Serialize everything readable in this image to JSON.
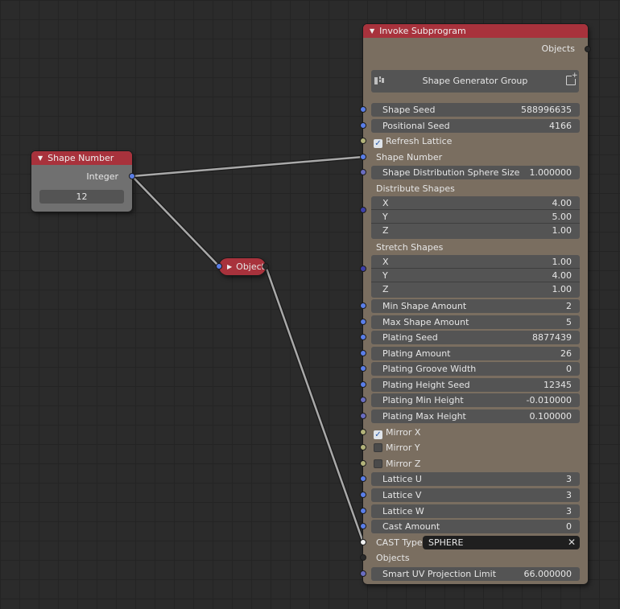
{
  "colors": {
    "header": "#a8323c",
    "socket_int": "#5a7ee8",
    "socket_float": "#6a6dc0",
    "socket_bool": "#b3b37a",
    "socket_object": "#f0f0f0"
  },
  "shape_number_node": {
    "title": "Shape Number",
    "output_label": "Integer",
    "value": "12"
  },
  "object_node": {
    "title": "Objects"
  },
  "invoke_node": {
    "title": "Invoke Subprogram",
    "output_label": "Objects",
    "group_name": "Shape Generator Group",
    "rows": {
      "shape_seed": {
        "label": "Shape Seed",
        "value": "588996635"
      },
      "positional_seed": {
        "label": "Positional Seed",
        "value": "4166"
      },
      "refresh_lattice": {
        "label": "Refresh Lattice",
        "checked": true
      },
      "shape_number": {
        "label": "Shape Number"
      },
      "sphere_size": {
        "label": "Shape Distribution Sphere Size",
        "value": "1.000000"
      },
      "distribute": {
        "label": "Distribute Shapes",
        "x_label": "X",
        "x": "4.00",
        "y_label": "Y",
        "y": "5.00",
        "z_label": "Z",
        "z": "1.00"
      },
      "stretch": {
        "label": "Stretch Shapes",
        "x_label": "X",
        "x": "1.00",
        "y_label": "Y",
        "y": "4.00",
        "z_label": "Z",
        "z": "1.00"
      },
      "min_shape": {
        "label": "Min Shape Amount",
        "value": "2"
      },
      "max_shape": {
        "label": "Max Shape Amount",
        "value": "5"
      },
      "plating_seed": {
        "label": "Plating Seed",
        "value": "8877439"
      },
      "plating_amount": {
        "label": "Plating Amount",
        "value": "26"
      },
      "groove_width": {
        "label": "Plating Groove Width",
        "value": "0"
      },
      "height_seed": {
        "label": "Plating Height Seed",
        "value": "12345"
      },
      "min_height": {
        "label": "Plating Min Height",
        "value": "-0.010000"
      },
      "max_height": {
        "label": "Plating Max Height",
        "value": "0.100000"
      },
      "mirror_x": {
        "label": "Mirror X",
        "checked": true
      },
      "mirror_y": {
        "label": "Mirror Y",
        "checked": false
      },
      "mirror_z": {
        "label": "Mirror Z",
        "checked": false
      },
      "lattice_u": {
        "label": "Lattice U",
        "value": "3"
      },
      "lattice_v": {
        "label": "Lattice V",
        "value": "3"
      },
      "lattice_w": {
        "label": "Lattice W",
        "value": "3"
      },
      "cast_amount": {
        "label": "Cast Amount",
        "value": "0"
      },
      "cast_type": {
        "label": "CAST Type:",
        "value": "SPHERE"
      },
      "objects_in": {
        "label": "Objects"
      },
      "uv_limit": {
        "label": "Smart UV Projection Limit",
        "value": "66.000000"
      }
    }
  }
}
